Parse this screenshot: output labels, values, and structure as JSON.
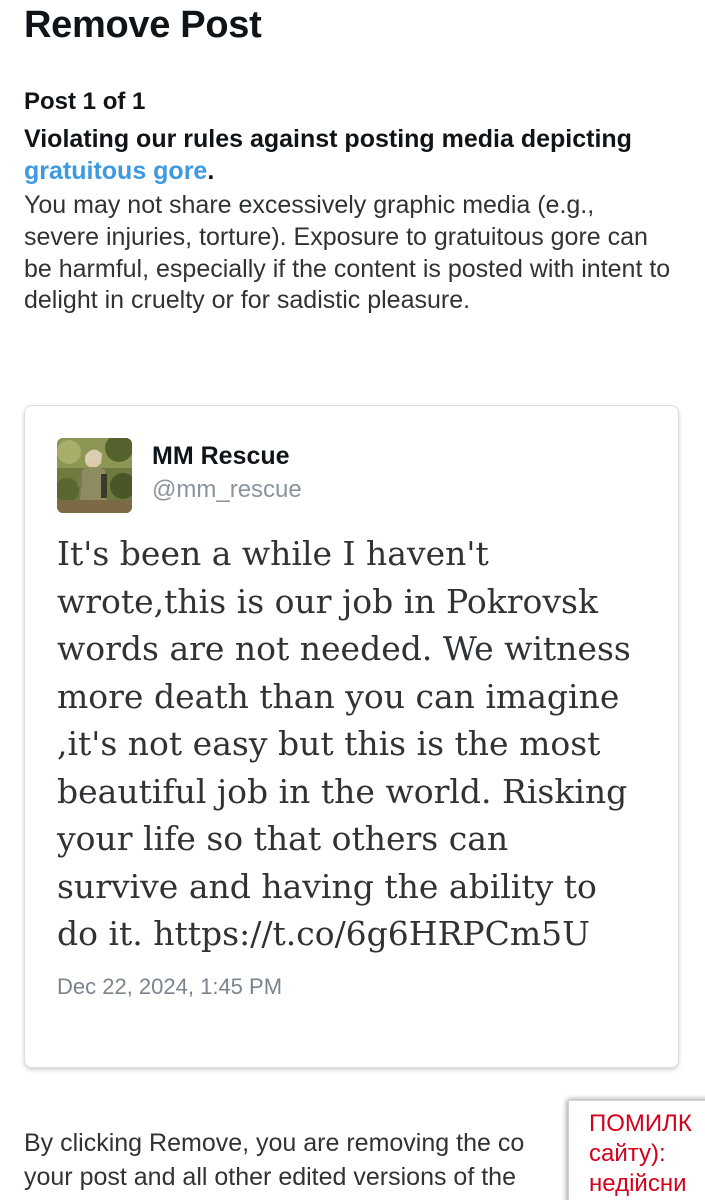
{
  "page": {
    "title": "Remove Post"
  },
  "notice": {
    "post_counter": "Post 1 of 1",
    "violation_prefix": "Violating our rules against posting media depicting ",
    "violation_link": "gratuitous gore",
    "violation_suffix": ".",
    "description": "You may not share excessively graphic media (e.g., severe injuries, torture). Exposure to gratuitous gore can be harmful, especially if the content is posted with intent to delight in cruelty or for sadistic pleasure."
  },
  "tweet": {
    "author_name": "MM Rescue",
    "author_handle": "@mm_rescue",
    "avatar_icon": "profile-photo",
    "text": "It's been a while I haven't\nwrote,this is our job in Pokrovsk\nwords are not needed. We witness\nmore death than you can imagine\n,it's not easy but this is the most\nbeautiful job in the world. Risking\nyour life so that others can\nsurvive and having the ability to\ndo it. https://t.co/6g6HRPCm5U",
    "date": "Dec 22, 2024, 1:45 PM"
  },
  "footer": {
    "text": "By clicking Remove, you are removing the co\nyour post and all other edited versions of the"
  },
  "error_popup": {
    "text": "ПОМИЛК\nсайту):\nнедійсни"
  },
  "colors": {
    "link": "#3d9ae0",
    "error": "#d6001c",
    "handle": "#8a949e"
  }
}
